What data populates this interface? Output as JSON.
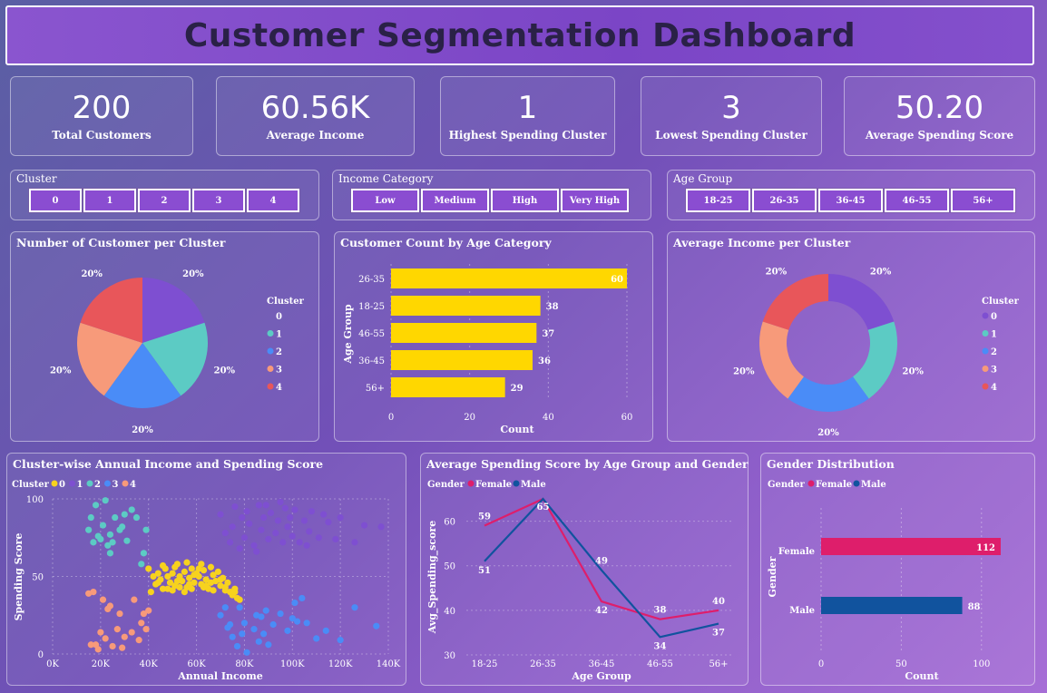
{
  "title": "Customer Segmentation Dashboard",
  "kpis": [
    {
      "value": "200",
      "label": "Total Customers"
    },
    {
      "value": "60.56K",
      "label": "Average Income"
    },
    {
      "value": "1",
      "label": "Highest Spending Cluster"
    },
    {
      "value": "3",
      "label": "Lowest Spending Cluster"
    },
    {
      "value": "50.20",
      "label": "Average Spending Score"
    }
  ],
  "slicers": {
    "cluster": {
      "title": "Cluster",
      "options": [
        "0",
        "1",
        "2",
        "3",
        "4"
      ]
    },
    "income": {
      "title": "Income Category",
      "options": [
        "Low",
        "Medium",
        "High",
        "Very High"
      ]
    },
    "age": {
      "title": "Age Group",
      "options": [
        "18-25",
        "26-35",
        "36-45",
        "46-55",
        "56+"
      ]
    }
  },
  "colors": {
    "cluster0": "#7e4fd1",
    "cluster1": "#5ccbc4",
    "cluster2": "#4a8cf7",
    "cluster3": "#f79a7a",
    "cluster4": "#e8565a",
    "scatter0": "#f7d21e",
    "bar": "#ffd700",
    "female": "#de1e6b",
    "male": "#11539e"
  },
  "chart_data": [
    {
      "type": "pie",
      "title": "Number of Customer per Cluster",
      "legend_title": "Cluster",
      "legend_placement": "right",
      "categories": [
        "0",
        "1",
        "2",
        "3",
        "4"
      ],
      "values": [
        20,
        20,
        20,
        20,
        20
      ],
      "labels": [
        "20%",
        "20%",
        "20%",
        "20%",
        "20%"
      ]
    },
    {
      "type": "bar",
      "orientation": "horizontal",
      "title": "Customer Count by Age Category",
      "xlabel": "Count",
      "ylabel": "Age Group",
      "categories": [
        "26-35",
        "18-25",
        "46-55",
        "36-45",
        "56+"
      ],
      "values": [
        60,
        38,
        37,
        36,
        29
      ],
      "xlim": [
        0,
        60
      ],
      "xticks": [
        "0",
        "20",
        "40",
        "60"
      ]
    },
    {
      "type": "pie",
      "variant": "donut",
      "title": "Average Income per Cluster",
      "legend_title": "Cluster",
      "legend_placement": "right",
      "categories": [
        "0",
        "1",
        "2",
        "3",
        "4"
      ],
      "values": [
        20,
        20,
        20,
        20,
        20
      ],
      "labels": [
        "20%",
        "20%",
        "20%",
        "20%",
        "20%"
      ]
    },
    {
      "type": "scatter",
      "title": "Cluster-wise Annual Income and Spending Score",
      "legend_title": "Cluster",
      "legend_placement": "top-left",
      "xlabel": "Annual Income",
      "ylabel": "Spending Score",
      "xlim": [
        0,
        140000
      ],
      "ylim": [
        0,
        100
      ],
      "xticks": [
        "0K",
        "20K",
        "40K",
        "60K",
        "80K",
        "100K",
        "120K",
        "140K"
      ],
      "yticks": [
        "0",
        "50",
        "100"
      ],
      "series": [
        {
          "name": "0",
          "points": [
            [
              40,
              55
            ],
            [
              42,
              50
            ],
            [
              43,
              45
            ],
            [
              44,
              52
            ],
            [
              45,
              48
            ],
            [
              46,
              42
            ],
            [
              47,
              55
            ],
            [
              48,
              50
            ],
            [
              49,
              46
            ],
            [
              50,
              52
            ],
            [
              51,
              44
            ],
            [
              52,
              58
            ],
            [
              53,
              50
            ],
            [
              54,
              47
            ],
            [
              55,
              53
            ],
            [
              56,
              43
            ],
            [
              57,
              49
            ],
            [
              58,
              55
            ],
            [
              59,
              46
            ],
            [
              60,
              52
            ],
            [
              61,
              50
            ],
            [
              62,
              45
            ],
            [
              63,
              54
            ],
            [
              64,
              48
            ],
            [
              65,
              42
            ],
            [
              66,
              56
            ],
            [
              67,
              51
            ],
            [
              68,
              47
            ],
            [
              69,
              53
            ],
            [
              70,
              44
            ],
            [
              71,
              49
            ],
            [
              72,
              41
            ],
            [
              73,
              46
            ],
            [
              74,
              40
            ],
            [
              75,
              38
            ],
            [
              76,
              42
            ],
            [
              77,
              36
            ],
            [
              78,
              35
            ],
            [
              41,
              40
            ],
            [
              48,
              42
            ],
            [
              55,
              40
            ],
            [
              62,
              58
            ],
            [
              66,
              46
            ],
            [
              58,
              42
            ],
            [
              52,
              47
            ],
            [
              44,
              46
            ],
            [
              67,
              41
            ],
            [
              70,
              48
            ],
            [
              76,
              40
            ],
            [
              61,
              55
            ],
            [
              59,
              51
            ],
            [
              46,
              57
            ],
            [
              51,
              56
            ],
            [
              56,
              59
            ],
            [
              64,
              44
            ],
            [
              72,
              43
            ],
            [
              63,
              43
            ],
            [
              50,
              41
            ],
            [
              57,
              45
            ],
            [
              53,
              43
            ]
          ]
        },
        {
          "name": "1",
          "points": [
            [
              70,
              90
            ],
            [
              72,
              78
            ],
            [
              75,
              82
            ],
            [
              76,
              95
            ],
            [
              78,
              68
            ],
            [
              79,
              88
            ],
            [
              80,
              75
            ],
            [
              81,
              92
            ],
            [
              82,
              84
            ],
            [
              84,
              70
            ],
            [
              86,
              96
            ],
            [
              87,
              80
            ],
            [
              88,
              88
            ],
            [
              90,
              74
            ],
            [
              91,
              91
            ],
            [
              93,
              78
            ],
            [
              94,
              86
            ],
            [
              96,
              72
            ],
            [
              97,
              94
            ],
            [
              98,
              82
            ],
            [
              99,
              88
            ],
            [
              100,
              76
            ],
            [
              101,
              93
            ],
            [
              103,
              72
            ],
            [
              105,
              86
            ],
            [
              107,
              79
            ],
            [
              108,
              92
            ],
            [
              111,
              75
            ],
            [
              113,
              90
            ],
            [
              115,
              85
            ],
            [
              118,
              74
            ],
            [
              120,
              88
            ],
            [
              126,
              72
            ],
            [
              130,
              83
            ],
            [
              137,
              82
            ],
            [
              95,
              98
            ],
            [
              85,
              66
            ],
            [
              74,
              72
            ],
            [
              89,
              96
            ],
            [
              106,
              70
            ]
          ]
        },
        {
          "name": "2",
          "points": [
            [
              15,
              80
            ],
            [
              16,
              88
            ],
            [
              17,
              72
            ],
            [
              18,
              96
            ],
            [
              19,
              76
            ],
            [
              20,
              74
            ],
            [
              21,
              83
            ],
            [
              22,
              99
            ],
            [
              23,
              70
            ],
            [
              24,
              77
            ],
            [
              25,
              72
            ],
            [
              26,
              88
            ],
            [
              28,
              80
            ],
            [
              29,
              82
            ],
            [
              31,
              73
            ],
            [
              33,
              93
            ],
            [
              35,
              88
            ],
            [
              38,
              65
            ],
            [
              39,
              80
            ],
            [
              30,
              90
            ],
            [
              37,
              58
            ],
            [
              24,
              65
            ]
          ]
        },
        {
          "name": "3",
          "points": [
            [
              70,
              25
            ],
            [
              72,
              30
            ],
            [
              73,
              17
            ],
            [
              75,
              11
            ],
            [
              77,
              5
            ],
            [
              78,
              30
            ],
            [
              79,
              13
            ],
            [
              80,
              20
            ],
            [
              81,
              1
            ],
            [
              84,
              16
            ],
            [
              85,
              25
            ],
            [
              86,
              8
            ],
            [
              87,
              24
            ],
            [
              88,
              13
            ],
            [
              89,
              28
            ],
            [
              90,
              6
            ],
            [
              95,
              26
            ],
            [
              98,
              15
            ],
            [
              101,
              33
            ],
            [
              102,
              21
            ],
            [
              104,
              36
            ],
            [
              106,
              20
            ],
            [
              110,
              10
            ],
            [
              114,
              15
            ],
            [
              120,
              9
            ],
            [
              126,
              30
            ],
            [
              135,
              18
            ],
            [
              74,
              19
            ],
            [
              100,
              23
            ],
            [
              92,
              19
            ]
          ]
        },
        {
          "name": "4",
          "points": [
            [
              15,
              39
            ],
            [
              16,
              6
            ],
            [
              17,
              40
            ],
            [
              18,
              6
            ],
            [
              19,
              3
            ],
            [
              20,
              14
            ],
            [
              21,
              35
            ],
            [
              23,
              29
            ],
            [
              24,
              31
            ],
            [
              25,
              5
            ],
            [
              28,
              26
            ],
            [
              29,
              4
            ],
            [
              30,
              11
            ],
            [
              33,
              14
            ],
            [
              34,
              35
            ],
            [
              36,
              9
            ],
            [
              37,
              20
            ],
            [
              38,
              26
            ],
            [
              39,
              16
            ],
            [
              40,
              28
            ],
            [
              22,
              10
            ],
            [
              27,
              16
            ]
          ]
        }
      ]
    },
    {
      "type": "line",
      "title": "Average Spending Score by Age Group and Gender",
      "legend_title": "Gender",
      "legend_placement": "top-left",
      "xlabel": "Age Group",
      "ylabel": "Avg_Spending_score",
      "categories": [
        "18-25",
        "26-35",
        "36-45",
        "46-55",
        "56+"
      ],
      "ylim": [
        30,
        65
      ],
      "yticks": [
        "30",
        "40",
        "50",
        "60"
      ],
      "series": [
        {
          "name": "Female",
          "values": [
            59,
            65,
            42,
            38,
            40
          ]
        },
        {
          "name": "Male",
          "values": [
            51,
            65,
            49,
            34,
            37
          ]
        }
      ]
    },
    {
      "type": "bar",
      "orientation": "horizontal",
      "title": "Gender Distribution",
      "legend_title": "Gender",
      "legend_placement": "top-left",
      "xlabel": "Count",
      "ylabel": "Gender",
      "categories": [
        "Female",
        "Male"
      ],
      "values": [
        112,
        88
      ],
      "xlim": [
        0,
        112
      ],
      "xticks": [
        "0",
        "50",
        "100"
      ]
    }
  ]
}
